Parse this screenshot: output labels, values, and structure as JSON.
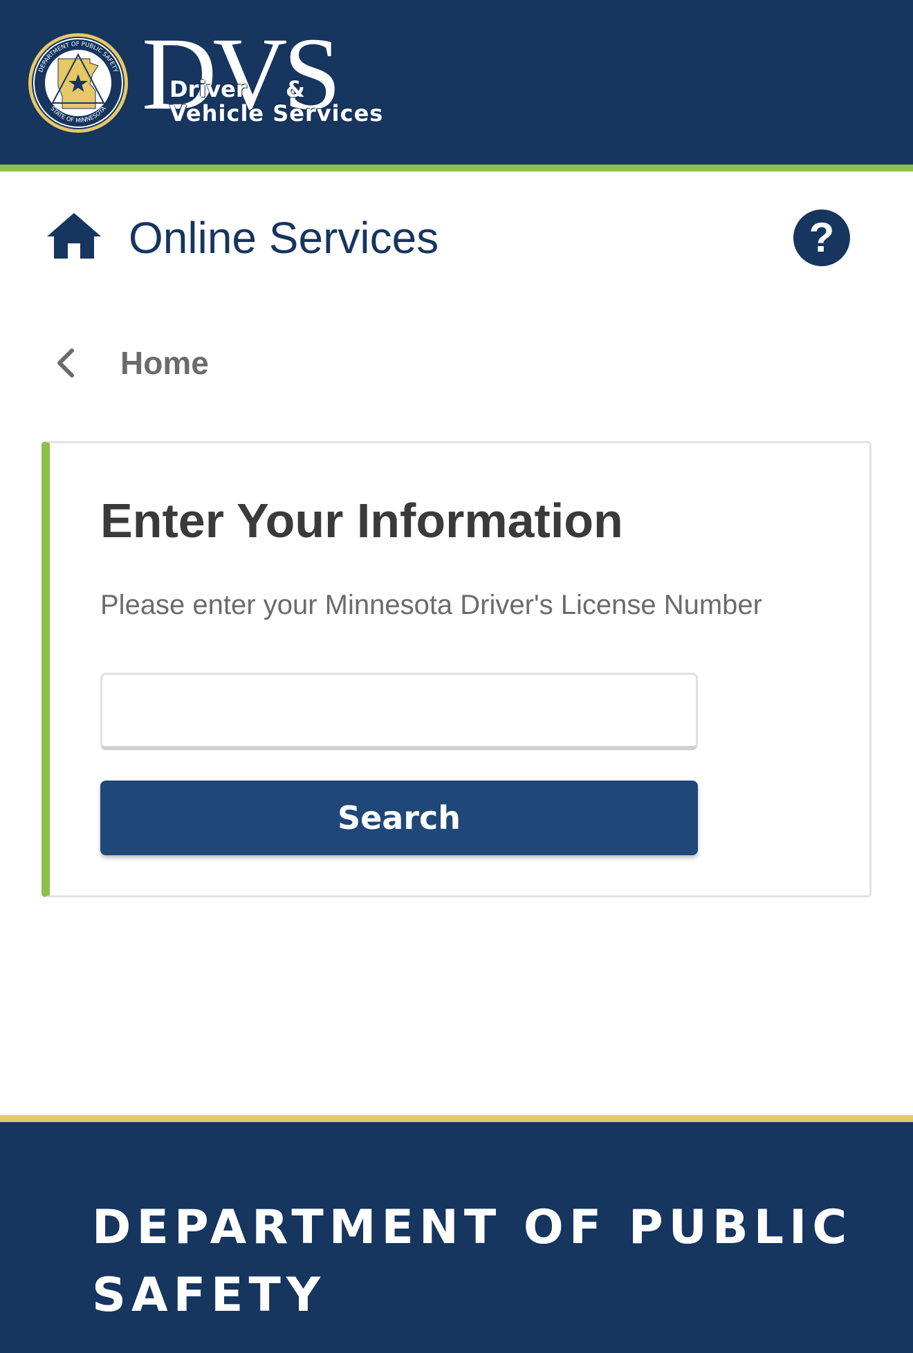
{
  "header": {
    "logo_big": "DVS",
    "logo_line1": "Driver",
    "logo_amp": "&",
    "logo_line2": "Vehicle Services",
    "seal_top_text": "DEPARTMENT OF PUBLIC SAFETY",
    "seal_bottom_text": "STATE OF MINNESOTA"
  },
  "nav": {
    "title": "Online Services",
    "help_glyph": "?"
  },
  "breadcrumb": {
    "back_label": "Home"
  },
  "form": {
    "title": "Enter Your Information",
    "prompt": "Please enter your Minnesota Driver's License Number",
    "license_value": "",
    "license_placeholder": "",
    "search_label": "Search"
  },
  "footer": {
    "title": "DEPARTMENT OF PUBLIC SAFETY"
  },
  "colors": {
    "navy": "#16355f",
    "green_accent": "#8bc04a",
    "gold_accent": "#e6c866",
    "button_blue": "#1f4778"
  },
  "icons": {
    "home": "home-icon",
    "help": "question-icon",
    "back": "chevron-left-icon",
    "seal": "mn-seal-icon"
  }
}
